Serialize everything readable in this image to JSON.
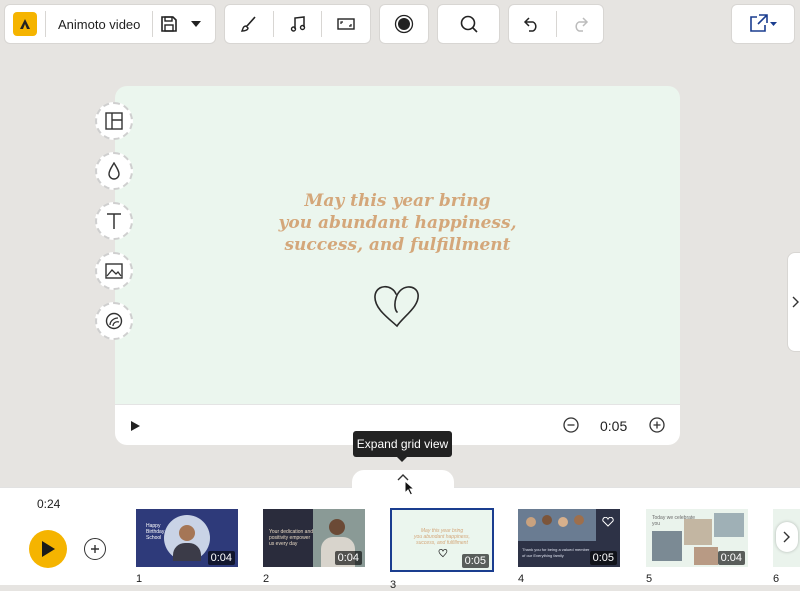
{
  "app": {
    "project_name": "Animoto video"
  },
  "canvas": {
    "quote": "May this year bring\nyou abundant happiness,\nsuccess, and fulfillment",
    "background": "#ebf6ee",
    "text_color": "#d4a77a"
  },
  "side_tools": [
    "layout-icon",
    "color-drop-icon",
    "text-icon",
    "image-icon",
    "sticker-icon"
  ],
  "playbar": {
    "duration": "0:05"
  },
  "tooltip": {
    "text": "Expand grid view"
  },
  "timeline": {
    "total_duration": "0:24",
    "scenes": [
      {
        "number": "1",
        "duration": "0:04",
        "text": "Happy\nBirthday\nSchool",
        "bg": "#2e3a7a"
      },
      {
        "number": "2",
        "duration": "0:04",
        "text": "Your dedication and\npositivity empower\nus every day",
        "bg": "#2a2c3c"
      },
      {
        "number": "3",
        "duration": "0:05",
        "text": "May this year bring\nyou abundant happiness,\nsuccess, and fulfillment",
        "bg": "#ebf6ee"
      },
      {
        "number": "4",
        "duration": "0:05",
        "text": "Thank you for being a valued member\nof our Everything family",
        "bg": "#2d3246"
      },
      {
        "number": "5",
        "duration": "0:04",
        "text": "Today we celebrate\nyou",
        "bg": "#eaf3ec"
      },
      {
        "number": "6",
        "duration": "",
        "text": "",
        "bg": "#eaf3ec"
      }
    ]
  },
  "colors": {
    "accent": "#f5b400",
    "selected_border": "#1a3d8f"
  }
}
